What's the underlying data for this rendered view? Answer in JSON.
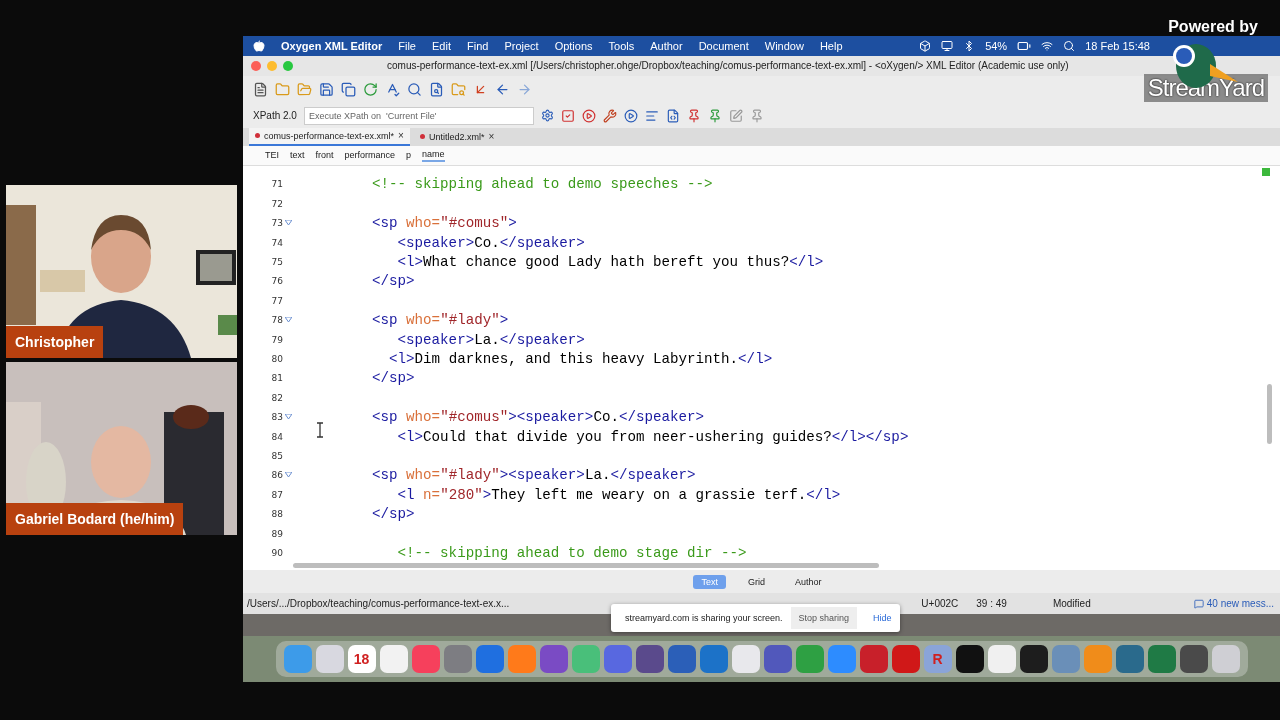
{
  "streamyard": {
    "powered_by": "Powered by",
    "brand": "StreamYard"
  },
  "participants": [
    {
      "name": "Christopher",
      "kind": "picture"
    },
    {
      "name": "Gabriel Bodard (he/him)",
      "kind": "picture"
    }
  ],
  "menu_bar": {
    "app": "Oxygen XML Editor",
    "items": [
      "File",
      "Edit",
      "Find",
      "Project",
      "Options",
      "Tools",
      "Author",
      "Document",
      "Window",
      "Help"
    ],
    "battery": "54%",
    "clock": "18 Feb 15:48"
  },
  "window": {
    "title": "comus-performance-text-ex.xml [/Users/christopher.ohge/Dropbox/teaching/comus-performance-text-ex.xml] - <oXygen/> XML Editor (Academic use only)"
  },
  "xpath": {
    "version": "XPath 2.0",
    "placeholder": "Execute XPath on  'Current File'"
  },
  "tabs": [
    {
      "label": "comus-performance-text-ex.xml*",
      "selected": true,
      "close": "×"
    },
    {
      "label": "Untitled2.xml*",
      "selected": false,
      "close": "×"
    }
  ],
  "breadcrumb": [
    {
      "label": "TEI",
      "selected": false
    },
    {
      "label": "text",
      "selected": false
    },
    {
      "label": "front",
      "selected": false
    },
    {
      "label": "performance",
      "selected": false
    },
    {
      "label": "p",
      "selected": false
    },
    {
      "label": "name",
      "selected": true
    }
  ],
  "editor": {
    "lines": [
      {
        "number": "71",
        "foldable": false,
        "tokens": [
          {
            "kind": "comment",
            "text": "<!-- skipping ahead to demo speeches -->"
          }
        ]
      },
      {
        "number": "72",
        "foldable": false
      },
      {
        "number": "73",
        "foldable": true,
        "tokens": [
          {
            "kind": "tag",
            "text": "<sp"
          },
          {
            "kind": "attr",
            "text": " who="
          },
          {
            "kind": "value",
            "text": "\"#comus\""
          },
          {
            "kind": "tag",
            "text": ">"
          }
        ]
      },
      {
        "number": "74",
        "foldable": false,
        "tokens": [
          {
            "kind": "tag",
            "text": "   <speaker>"
          },
          {
            "kind": "text",
            "text": "Co."
          },
          {
            "kind": "tag",
            "text": "</speaker>"
          }
        ]
      },
      {
        "number": "75",
        "foldable": false,
        "tokens": [
          {
            "kind": "tag",
            "text": "   <l>"
          },
          {
            "kind": "text",
            "text": "What chance good Lady hath bereft you thus?"
          },
          {
            "kind": "tag",
            "text": "</l>"
          }
        ]
      },
      {
        "number": "76",
        "foldable": false,
        "tokens": [
          {
            "kind": "tag",
            "text": "</sp>"
          }
        ]
      },
      {
        "number": "77",
        "foldable": false
      },
      {
        "number": "78",
        "foldable": true,
        "tokens": [
          {
            "kind": "tag",
            "text": "<sp"
          },
          {
            "kind": "attr",
            "text": " who="
          },
          {
            "kind": "value",
            "text": "\"#lady\""
          },
          {
            "kind": "tag",
            "text": ">"
          }
        ]
      },
      {
        "number": "79",
        "foldable": false,
        "tokens": [
          {
            "kind": "tag",
            "text": "   <speaker>"
          },
          {
            "kind": "text",
            "text": "La."
          },
          {
            "kind": "tag",
            "text": "</speaker>"
          }
        ]
      },
      {
        "number": "80",
        "foldable": false,
        "tokens": [
          {
            "kind": "tag",
            "text": "  <l>"
          },
          {
            "kind": "text",
            "text": "Dim darknes, and this heavy Labyrinth."
          },
          {
            "kind": "tag",
            "text": "</l>"
          }
        ]
      },
      {
        "number": "81",
        "foldable": false,
        "tokens": [
          {
            "kind": "tag",
            "text": "</sp>"
          }
        ]
      },
      {
        "number": "82",
        "foldable": false
      },
      {
        "number": "83",
        "foldable": true,
        "tokens": [
          {
            "kind": "tag",
            "text": "<sp"
          },
          {
            "kind": "attr",
            "text": " who="
          },
          {
            "kind": "value",
            "text": "\"#comus\""
          },
          {
            "kind": "tag",
            "text": "><speaker>"
          },
          {
            "kind": "text",
            "text": "Co."
          },
          {
            "kind": "tag",
            "text": "</speaker>"
          }
        ]
      },
      {
        "number": "84",
        "foldable": false,
        "tokens": [
          {
            "kind": "tag",
            "text": "   <l>"
          },
          {
            "kind": "text",
            "text": "Could that divide you from neer-ushering guides?"
          },
          {
            "kind": "tag",
            "text": "</l></sp>"
          }
        ]
      },
      {
        "number": "85",
        "foldable": false
      },
      {
        "number": "86",
        "foldable": true,
        "tokens": [
          {
            "kind": "tag",
            "text": "<sp"
          },
          {
            "kind": "attr",
            "text": " who="
          },
          {
            "kind": "value",
            "text": "\"#lady\""
          },
          {
            "kind": "tag",
            "text": "><speaker>"
          },
          {
            "kind": "text",
            "text": "La."
          },
          {
            "kind": "tag",
            "text": "</speaker>"
          }
        ]
      },
      {
        "number": "87",
        "foldable": false,
        "tokens": [
          {
            "kind": "tag",
            "text": "   <l"
          },
          {
            "kind": "attr",
            "text": " n="
          },
          {
            "kind": "value",
            "text": "\"280\""
          },
          {
            "kind": "tag",
            "text": ">"
          },
          {
            "kind": "text",
            "text": "They left me weary on a grassie terf."
          },
          {
            "kind": "tag",
            "text": "</l>"
          }
        ]
      },
      {
        "number": "88",
        "foldable": false,
        "tokens": [
          {
            "kind": "tag",
            "text": "</sp>"
          }
        ]
      },
      {
        "number": "89",
        "foldable": false
      },
      {
        "number": "90",
        "foldable": false,
        "tokens": [
          {
            "kind": "comment",
            "text": "   <!-- skipping ahead to demo stage dir -->"
          }
        ]
      }
    ]
  },
  "mode_tabs": [
    {
      "label": "Text",
      "selected": true
    },
    {
      "label": "Grid",
      "selected": false
    },
    {
      "label": "Author",
      "selected": false
    }
  ],
  "status_bar": {
    "path": "/Users/.../Dropbox/teaching/comus-performance-text-ex.x...",
    "char": "U+002C",
    "position": "39 : 49",
    "state": "Modified",
    "messages": "40 new mess..."
  },
  "share_notice": {
    "message": "streamyard.com is sharing your screen.",
    "stop": "Stop sharing",
    "hide": "Hide"
  },
  "dock": [
    {
      "color": "#3d9be9"
    },
    {
      "color": "#d8d8e0"
    },
    {
      "color": "#ffffff",
      "label": "18"
    },
    {
      "color": "#f2f2f2"
    },
    {
      "color": "#f6405c"
    },
    {
      "color": "#7d7d82"
    },
    {
      "color": "#1f6fe0"
    },
    {
      "color": "#ff7a1a"
    },
    {
      "color": "#7a4bc4"
    },
    {
      "color": "#49bf7a"
    },
    {
      "color": "#5868e0"
    },
    {
      "color": "#5a4a8c"
    },
    {
      "color": "#2b5fb8"
    },
    {
      "color": "#1c72c8"
    },
    {
      "color": "#e8e8ec"
    },
    {
      "color": "#5158bb"
    },
    {
      "color": "#2ea043"
    },
    {
      "color": "#2d8cff"
    },
    {
      "color": "#c8202a"
    },
    {
      "color": "#d01818"
    },
    {
      "color": "#8aa4d8",
      "label": "R"
    },
    {
      "color": "#111111"
    },
    {
      "color": "#f0f0f0"
    },
    {
      "color": "#1d1d1d"
    },
    {
      "color": "#6a8fb8"
    },
    {
      "color": "#f08c1a"
    },
    {
      "color": "#2a6a8c"
    },
    {
      "color": "#1f7a45"
    },
    {
      "color": "#4a4a4a"
    },
    {
      "color": "#cfcfd4"
    }
  ]
}
